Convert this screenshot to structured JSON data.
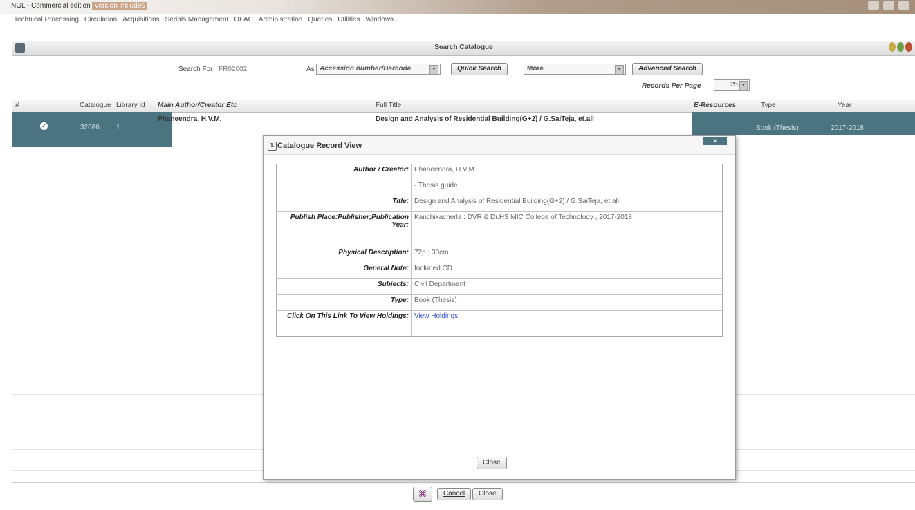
{
  "window": {
    "title_prefix": "NGL - Commercial edition",
    "title_hl": "Version includes"
  },
  "menu": [
    "Technical Processing",
    "Circulation",
    "Acquisitions",
    "Serials Management",
    "OPAC",
    "Administration",
    "Queries",
    "Utilities",
    "Windows"
  ],
  "search": {
    "header_title": "Search Catalogue",
    "search_for_label": "Search For",
    "search_for_value": "FR02002",
    "as_label": "As",
    "as_value": "Accession number/Barcode",
    "quick_search": "Quick Search",
    "more_value": "More",
    "advanced_search": "Advanced Search",
    "records_per_page_label": "Records Per Page",
    "records_per_page_value": "25"
  },
  "table": {
    "columns": [
      "#",
      "Catalogue",
      "Library Id",
      "Main Author/Creator Etc",
      "Full Title",
      "E-Resources",
      "Type",
      "Year"
    ],
    "row": {
      "catalogue": "32086",
      "library_id": "1",
      "author": "Phaneendra, H.V.M.",
      "title": "Design and Analysis of Residential Building(G+2) / G.SaiTeja, et.all",
      "type": "Book (Thesis)",
      "year": "2017-2018"
    }
  },
  "dialog": {
    "title": "Catalogue Record View",
    "rows": [
      {
        "label": "Author / Creator:",
        "value": "Phaneendra, H.V.M."
      },
      {
        "label": "",
        "value": "- Thesis guide"
      },
      {
        "label": "Title:",
        "value": "Design and Analysis of Residential Building(G+2) / G.SaiTeja, et.all"
      },
      {
        "label": "Publish Place:Publisher;Publication Year:",
        "value": "Kanchikacherla : DVR & Dr.HS MIC College of Technology , 2017-2018"
      },
      {
        "label": "Physical Description:",
        "value": "72p ; 30cm"
      },
      {
        "label": "General Note:",
        "value": "Included CD"
      },
      {
        "label": "Subjects:",
        "value": "Civil Department"
      },
      {
        "label": "Type:",
        "value": "Book (Thesis)"
      },
      {
        "label": "Click On This Link To View Holdings:",
        "value": "View Holdings",
        "link": true
      }
    ],
    "close_label": "Close"
  },
  "footer": {
    "cancel_label": "Cancel",
    "close_label": "Close"
  }
}
